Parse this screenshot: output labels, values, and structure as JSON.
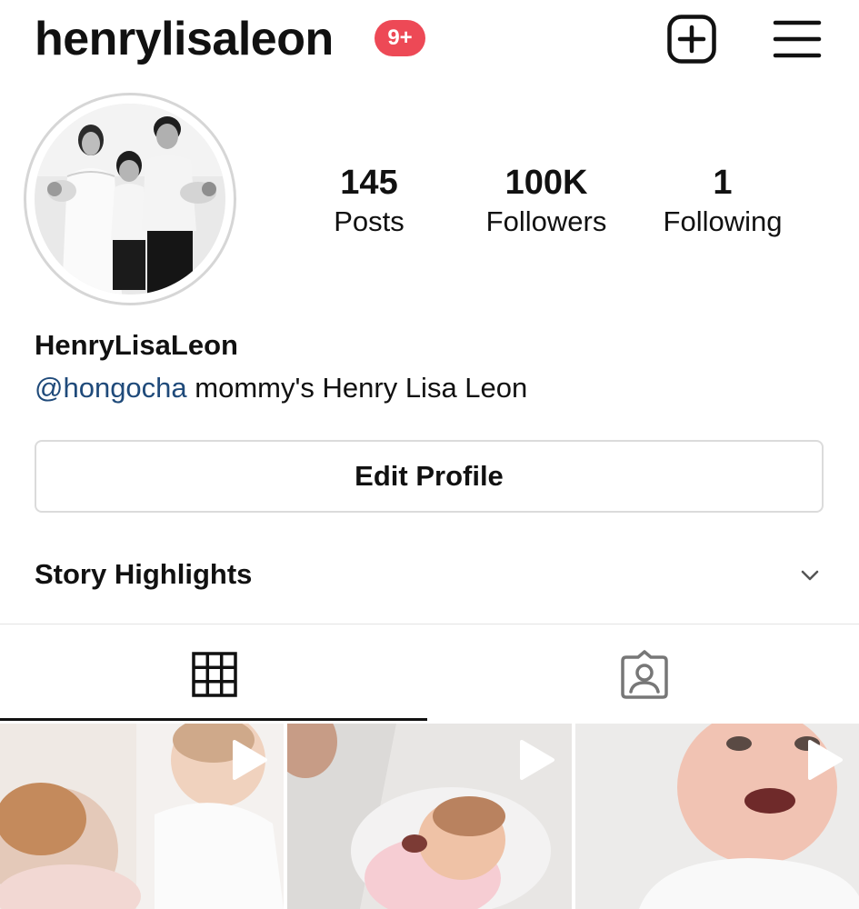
{
  "header": {
    "username": "henrylisaleon",
    "notification_badge": "9+",
    "new_post_icon": "plus-square-icon",
    "menu_icon": "hamburger-menu-icon"
  },
  "profile": {
    "avatar": "family-portrait-avatar",
    "stats": [
      {
        "value": "145",
        "label": "Posts"
      },
      {
        "value": "100K",
        "label": "Followers"
      },
      {
        "value": "1",
        "label": "Following"
      }
    ],
    "display_name": "HenryLisaLeon",
    "bio_mention": "@hongocha",
    "bio_text": " mommy's Henry Lisa Leon",
    "edit_profile_label": "Edit Profile"
  },
  "highlights": {
    "label": "Story Highlights",
    "chevron_icon": "chevron-down-icon"
  },
  "tabs": [
    {
      "icon": "grid-icon",
      "active": true
    },
    {
      "icon": "tagged-person-icon",
      "active": false
    }
  ],
  "posts": [
    {
      "type": "video",
      "icon": "play-icon"
    },
    {
      "type": "video",
      "icon": "play-icon"
    },
    {
      "type": "video",
      "icon": "play-icon"
    }
  ],
  "colors": {
    "badge": "#ed4956",
    "mention": "#1f4a7a",
    "border": "#dbdbdb",
    "text": "#111111"
  }
}
